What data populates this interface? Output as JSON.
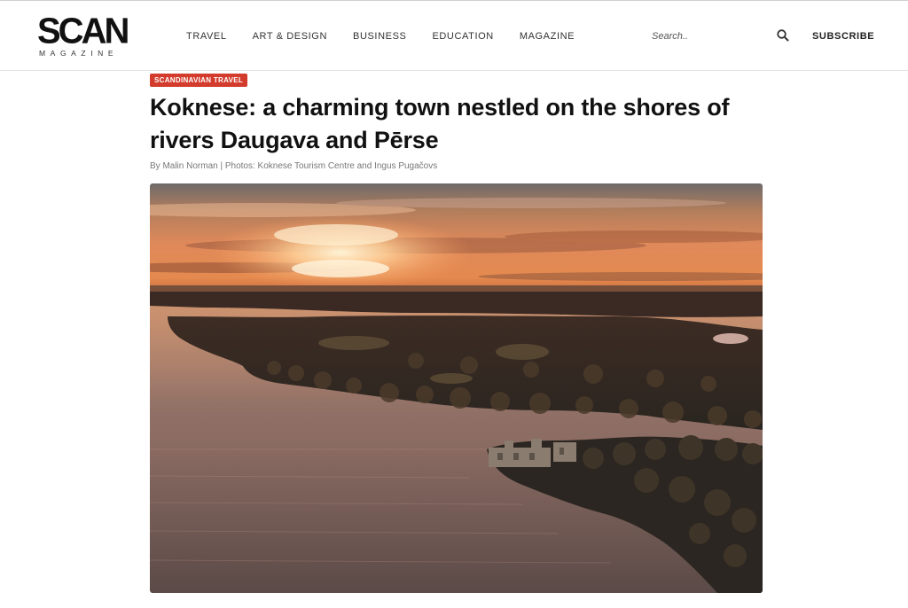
{
  "logo": {
    "main": "SCAN",
    "sub": "MAGAZINE"
  },
  "nav": {
    "items": [
      {
        "label": "TRAVEL"
      },
      {
        "label": "ART & DESIGN"
      },
      {
        "label": "BUSINESS"
      },
      {
        "label": "EDUCATION"
      },
      {
        "label": "MAGAZINE"
      }
    ]
  },
  "search": {
    "placeholder": "Search..",
    "icon": "search-icon"
  },
  "subscribe": {
    "label": "SUBSCRIBE"
  },
  "article": {
    "category": "SCANDINAVIAN TRAVEL",
    "category_color": "#d33b2c",
    "title": "Koknese: a charming town nestled on the shores of rivers Daugava and Pērse",
    "byline": "By Malin Norman | Photos: Koknese Tourism Centre and Ingus Pugačovs"
  }
}
